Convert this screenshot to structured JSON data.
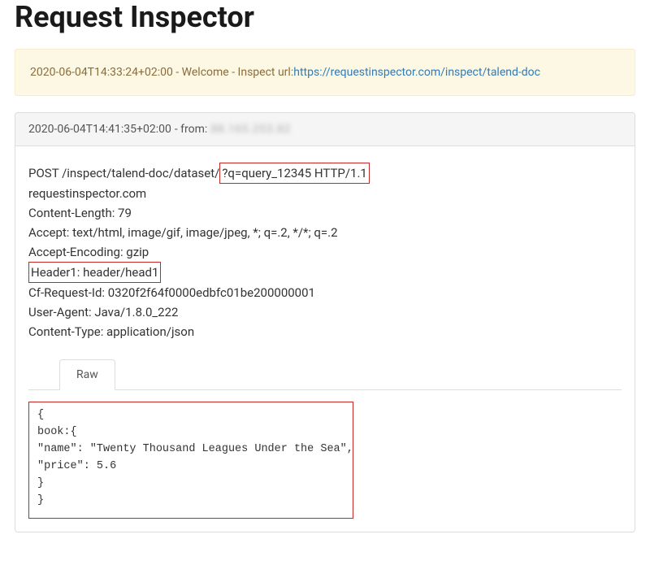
{
  "page": {
    "title": "Request Inspector"
  },
  "welcome": {
    "timestamp": "2020-06-04T14:33:24+02:00",
    "separator": " - ",
    "message": "Welcome - Inspect url:",
    "link_text": "https://requestinspector.com/inspect/talend-doc"
  },
  "request": {
    "header_bar": {
      "timestamp": "2020-06-04T14:41:35+02:00",
      "from_label": " - from: ",
      "from_value": "88.165.253.82"
    },
    "first_line": {
      "pre": "POST /inspect/talend-doc/dataset/",
      "highlight": "?q=query_12345 HTTP/1.1"
    },
    "headers": [
      "requestinspector.com",
      "Content-Length: 79",
      "Accept: text/html, image/gif, image/jpeg, *; q=.2, */*; q=.2",
      "Accept-Encoding: gzip"
    ],
    "highlighted_header": "Header1: header/head1",
    "headers_after": [
      "Cf-Request-Id: 0320f2f64f0000edbfc01be200000001",
      "User-Agent: Java/1.8.0_222",
      "Content-Type: application/json"
    ],
    "tab_label": "Raw",
    "raw_body": "{\nbook:{\n\"name\": \"Twenty Thousand Leagues Under the Sea\",\n\"price\": 5.6\n}\n}"
  }
}
